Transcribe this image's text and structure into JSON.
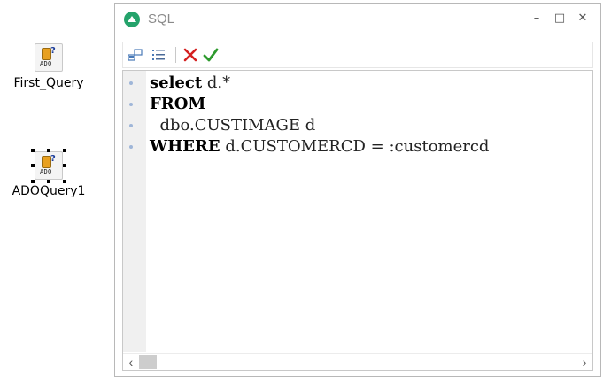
{
  "components": [
    {
      "label": "First_Query",
      "icon": "ado-query-icon",
      "badge": "ADO",
      "selected": false
    },
    {
      "label": "ADOQuery1",
      "icon": "ado-query-icon",
      "badge": "ADO",
      "selected": true
    }
  ],
  "window": {
    "title": "SQL",
    "buttons": {
      "minimize": "–",
      "maximize": "□",
      "close": "✕"
    }
  },
  "toolbar": {
    "items": [
      "component-list-icon",
      "field-list-icon",
      "cancel-icon",
      "ok-icon"
    ]
  },
  "editor": {
    "lines": [
      {
        "keyword": "select",
        "rest": " d.*"
      },
      {
        "keyword": "FROM",
        "rest": ""
      },
      {
        "keyword": "",
        "rest": "  dbo.CUSTIMAGE d"
      },
      {
        "keyword": "WHERE",
        "rest": " d.CUSTOMERCD = :customercd"
      }
    ]
  },
  "scrollbar": {
    "left": "‹",
    "right": "›"
  },
  "colors": {
    "accent": "#24a36b",
    "cancel": "#d42020",
    "ok": "#2e9a2e",
    "gutter_dot": "#9fb6d8"
  }
}
